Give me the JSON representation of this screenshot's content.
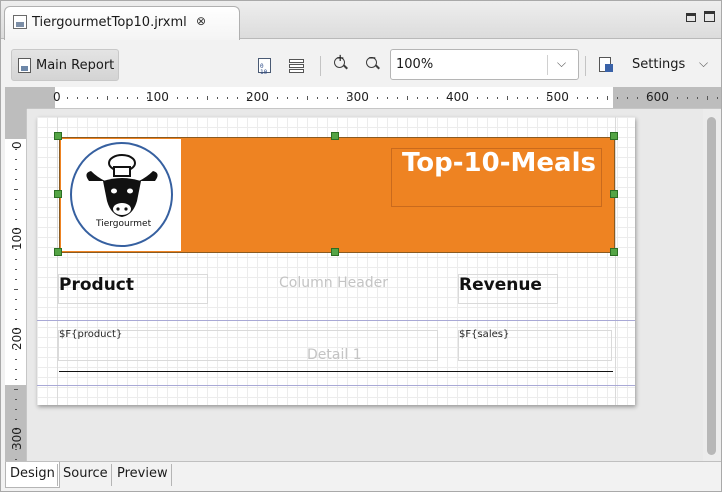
{
  "editor": {
    "tab_title": "TiergourmetTop10.jrxml",
    "tab_icon": "report-file-icon"
  },
  "toolbar": {
    "main_report_label": "Main Report",
    "zoom_value": "100%",
    "settings_label": "Settings"
  },
  "rulers": {
    "top_labels": [
      "0",
      "100",
      "200",
      "300",
      "400",
      "500",
      "600"
    ],
    "left_labels": [
      "0",
      "100",
      "200",
      "300"
    ]
  },
  "report": {
    "title": "Top-10-Meals",
    "title_band_color": "#ee8322",
    "logo_text": "Tiergourmet",
    "column_header_label": "Column Header",
    "header_product": "Product",
    "header_revenue": "Revenue",
    "detail_label": "Detail 1",
    "field_product": "$F{product}",
    "field_sales": "$F{sales}"
  },
  "bottom_tabs": [
    "Design",
    "Source",
    "Preview"
  ]
}
